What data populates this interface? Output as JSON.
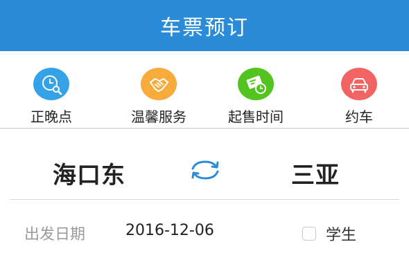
{
  "header": {
    "title": "车票预订",
    "bg_color": "#2a8bd8"
  },
  "quick_actions": [
    {
      "label": "正晚点",
      "icon": "clock-search-icon",
      "color": "#35a2e8"
    },
    {
      "label": "温馨服务",
      "icon": "handshake-icon",
      "color": "#f6ab3b"
    },
    {
      "label": "起售时间",
      "icon": "ticket-clock-icon",
      "color": "#52c31f"
    },
    {
      "label": "约车",
      "icon": "car-icon",
      "color": "#f16463"
    }
  ],
  "route": {
    "from": "海口东",
    "to": "三亚",
    "swap_icon": "swap-arrows-icon",
    "swap_color": "#2a8bd8"
  },
  "date_row": {
    "label": "出发日期",
    "value": "2016-12-06",
    "student_label": "学生",
    "student_checked": false
  }
}
